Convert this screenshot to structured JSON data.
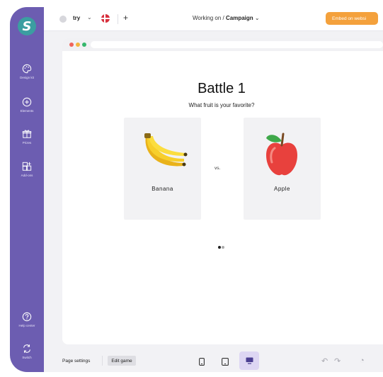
{
  "sidebar": {
    "items": [
      {
        "label": "Design kit",
        "icon": "palette-icon"
      },
      {
        "label": "Elements",
        "icon": "plus-circle-icon"
      },
      {
        "label": "Prizes",
        "icon": "gift-icon"
      },
      {
        "label": "Add-ons",
        "icon": "add-ons-icon"
      }
    ],
    "bottom_items": [
      {
        "label": "Help center",
        "icon": "help-icon"
      },
      {
        "label": "Switch",
        "icon": "switch-icon"
      }
    ],
    "colors": {
      "background": "#6c5db1",
      "logo": "#3b9ea1"
    }
  },
  "topbar": {
    "project_name": "try",
    "working_on_label": "Working on /",
    "campaign_label": "Campaign",
    "embed_button": "Embed on websi",
    "embed_color": "#f4a13c",
    "language_flag": "denmark-flag-icon"
  },
  "game": {
    "title": "Battle 1",
    "subtitle": "What fruit is your favorite?",
    "vs_label": "vs.",
    "options": [
      {
        "name": "Banana",
        "icon": "banana-icon"
      },
      {
        "name": "Apple",
        "icon": "apple-icon"
      }
    ],
    "pagination": {
      "current": 1,
      "total": 2
    }
  },
  "bottombar": {
    "page_settings_label": "Page settings",
    "edit_game_label": "Edit game",
    "devices": [
      {
        "name": "mobile",
        "active": false
      },
      {
        "name": "tablet",
        "active": false
      },
      {
        "name": "desktop",
        "active": true
      }
    ]
  }
}
